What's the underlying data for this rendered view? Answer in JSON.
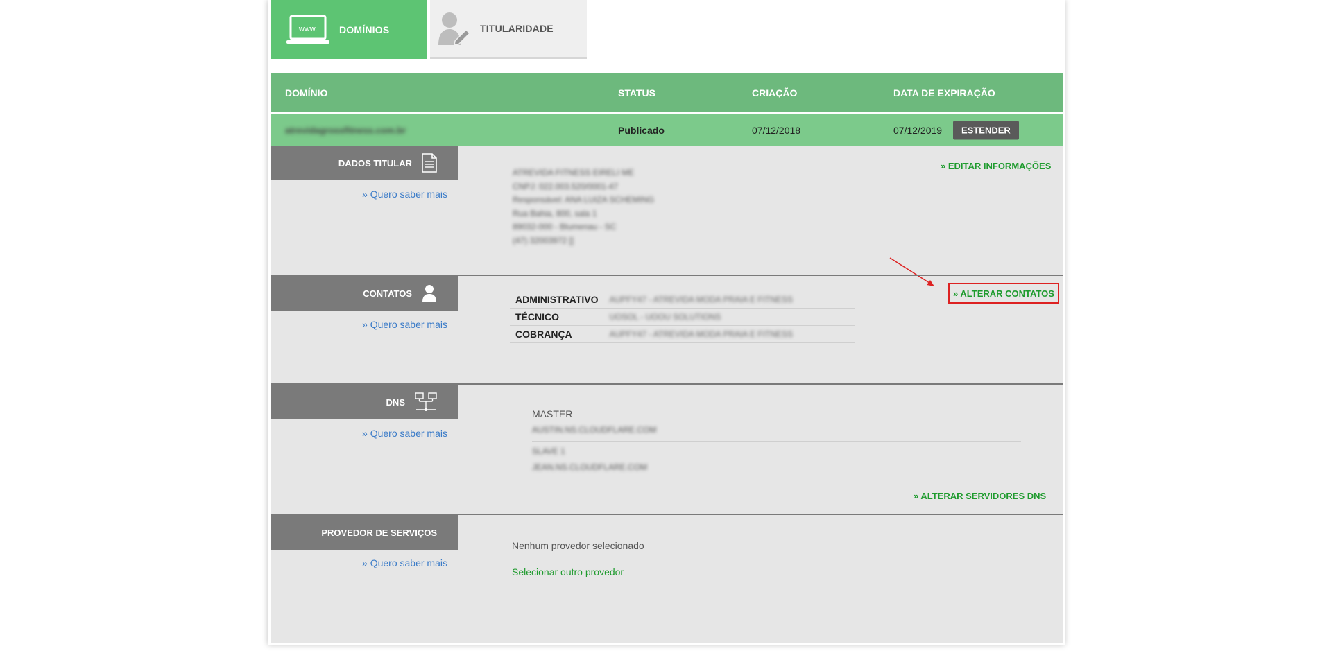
{
  "tabs": {
    "dominios": "DOMÍNIOS",
    "titularidade": "TITULARIDADE",
    "www_icon_text": "www."
  },
  "domain_table": {
    "headers": {
      "dominio": "DOMÍNIO",
      "status": "STATUS",
      "criacao": "CRIAÇÃO",
      "expiracao": "DATA DE EXPIRAÇÃO"
    },
    "row": {
      "dominio": "atrevidagrossfitness.com.br",
      "status": "Publicado",
      "criacao": "07/12/2018",
      "expiracao": "07/12/2019",
      "action": "ESTENDER"
    }
  },
  "sections": {
    "titular": {
      "title": "DADOS TITULAR",
      "saber": "» Quero saber mais",
      "edit_link": "» EDITAR INFORMAÇÕES",
      "info_lines": [
        "ATREVIDA FITNESS EIRELI ME",
        "CNPJ: 022.003.520/0001-47",
        "Responsável: ANA LUIZA SCHEMING",
        "Rua Bahia, 800, sala 1",
        "89032-000 - Blumenau - SC",
        "(47) 32003972 []"
      ]
    },
    "contatos": {
      "title": "CONTATOS",
      "saber": "» Quero saber mais",
      "action": "» ALTERAR CONTATOS",
      "rows": [
        {
          "label": "ADMINISTRATIVO",
          "value": "AUPFY47 - ATREVIDA MODA PRAIA E FITNESS"
        },
        {
          "label": "TÉCNICO",
          "value": "UOSOL - UOOU SOLUTIONS"
        },
        {
          "label": "COBRANÇA",
          "value": "AUPFY47 - ATREVIDA MODA PRAIA E FITNESS"
        }
      ]
    },
    "dns": {
      "title": "DNS",
      "saber": "» Quero saber mais",
      "master_label": "MASTER",
      "master_value": "AUSTIN.NS.CLOUDFLARE.COM",
      "slave_label": "SLAVE 1",
      "slave_value": "JEAN.NS.CLOUDFLARE.COM",
      "action": "» ALTERAR SERVIDORES DNS"
    },
    "provedor": {
      "title": "PROVEDOR DE SERVIÇOS",
      "saber": "» Quero saber mais",
      "status_text": "Nenhum provedor selecionado",
      "select_link": "Selecionar outro provedor"
    }
  },
  "icons": [
    "laptop-www-icon",
    "user-edit-icon",
    "document-icon",
    "user-icon",
    "network-icon",
    "red-arrow-annotation"
  ],
  "colors": {
    "tab_active": "#5dc473",
    "table_header": "#6db97d",
    "table_row": "#7cca8b",
    "section_title": "#7a7a7a",
    "link_green": "#1f9b2e",
    "link_blue": "#3a7bc8",
    "highlight_red": "#dd2222"
  }
}
